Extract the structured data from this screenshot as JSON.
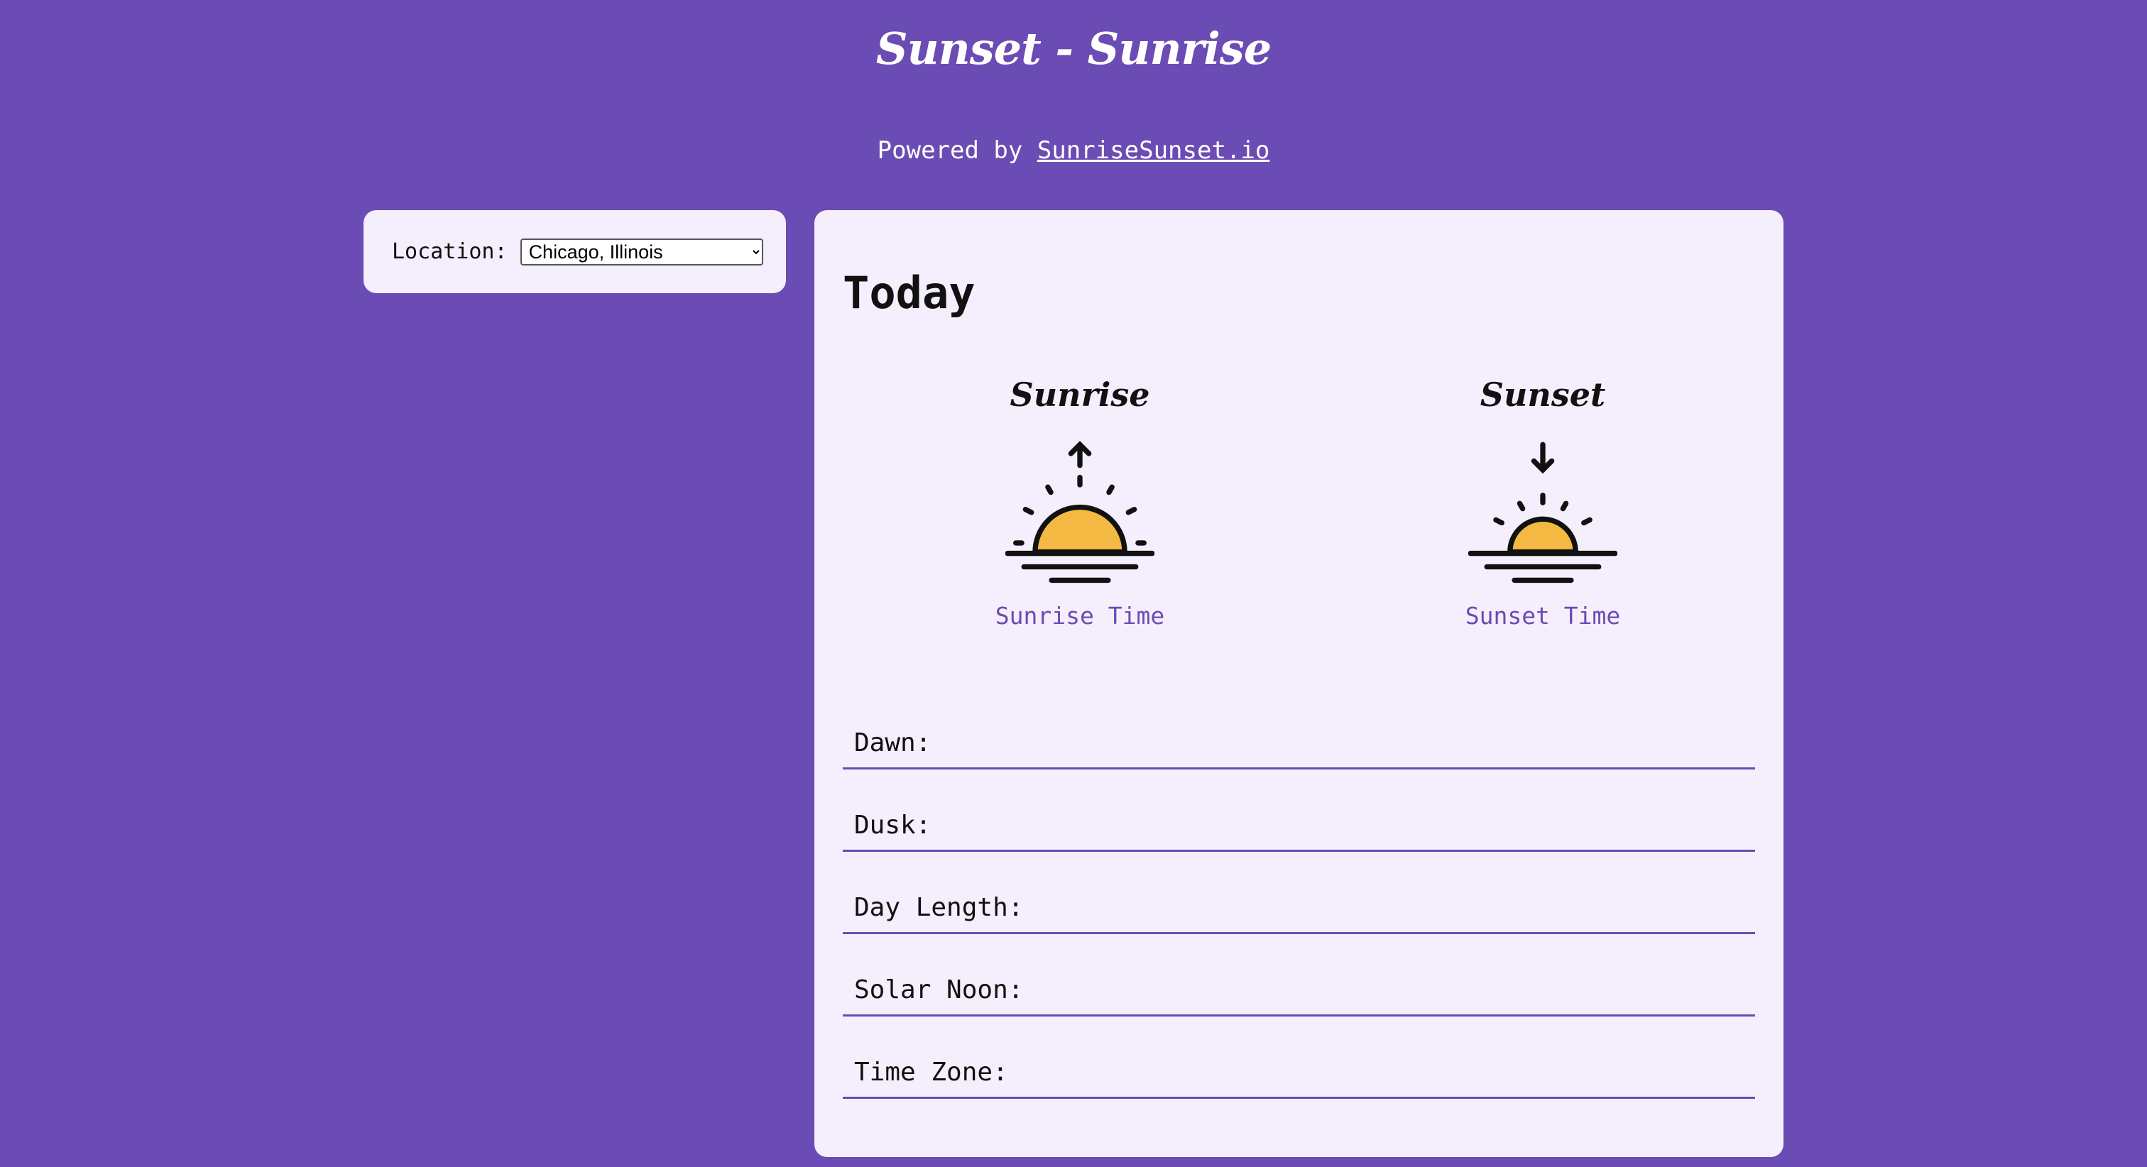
{
  "header": {
    "title": "Sunset - Sunrise",
    "powered_prefix": "Powered by ",
    "powered_link": "SunriseSunset.io"
  },
  "location": {
    "label": "Location:",
    "selected": "Chicago, Illinois"
  },
  "today": {
    "heading": "Today",
    "sunrise": {
      "title": "Sunrise",
      "time_label": "Sunrise Time",
      "icon": "sunrise-icon"
    },
    "sunset": {
      "title": "Sunset",
      "time_label": "Sunset Time",
      "icon": "sunset-icon"
    },
    "details": [
      {
        "label": "Dawn:"
      },
      {
        "label": "Dusk:"
      },
      {
        "label": "Day Length:"
      },
      {
        "label": "Solar Noon:"
      },
      {
        "label": "Time Zone:"
      }
    ]
  },
  "colors": {
    "background": "#6b4bb4",
    "card": "#f5eefc",
    "accent": "#6b4bb4",
    "sun": "#f4b942"
  }
}
